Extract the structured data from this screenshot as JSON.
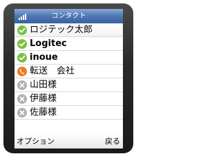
{
  "header": {
    "title": "コンタクト",
    "signal_icon": "signal-bars-icon"
  },
  "contacts": [
    {
      "name": "ロジテック太郎",
      "status": "online",
      "icon": "online-check-icon",
      "bold": false
    },
    {
      "name": "Logitec",
      "status": "online",
      "icon": "online-check-icon",
      "bold": true
    },
    {
      "name": "inoue",
      "status": "online",
      "icon": "online-check-icon",
      "bold": true
    },
    {
      "name": "転送　会社",
      "status": "forwarding",
      "icon": "phone-forward-icon",
      "bold": false
    },
    {
      "name": "山田様",
      "status": "offline",
      "icon": "offline-x-icon",
      "bold": false
    },
    {
      "name": "伊藤様",
      "status": "offline",
      "icon": "offline-x-icon",
      "bold": false
    },
    {
      "name": "佐藤様",
      "status": "offline",
      "icon": "offline-x-icon",
      "bold": false
    }
  ],
  "softkeys": {
    "left": "オプション",
    "right": "戻る"
  },
  "colors": {
    "online": "#7ac143",
    "forwarding": "#f07a28",
    "offline": "#b0b0b0",
    "titlebar": "#4f76b5"
  }
}
